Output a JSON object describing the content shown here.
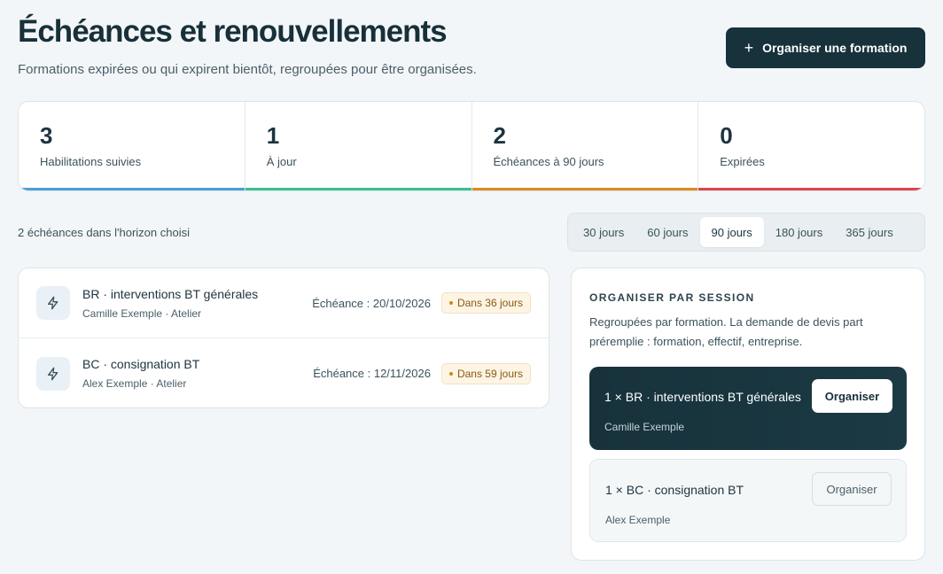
{
  "header": {
    "title": "Échéances et renouvellements",
    "subtitle": "Formations expirées ou qui expirent bientôt, regroupées pour être organisées.",
    "primary_button": "Organiser une formation"
  },
  "stats": [
    {
      "value": "3",
      "label": "Habilitations suivies",
      "color": "#4a9fd4"
    },
    {
      "value": "1",
      "label": "À jour",
      "color": "#3bbf93"
    },
    {
      "value": "2",
      "label": "Échéances à 90 jours",
      "color": "#d98a24"
    },
    {
      "value": "0",
      "label": "Expirées",
      "color": "#d9474a"
    }
  ],
  "filter": {
    "count_text": "2 échéances dans l'horizon choisi",
    "options": [
      "30 jours",
      "60 jours",
      "90 jours",
      "180 jours",
      "365 jours"
    ],
    "selected": "90 jours"
  },
  "items": [
    {
      "title": "BR · interventions BT générales",
      "subtitle": "Camille Exemple · Atelier",
      "date": "Échéance : 20/10/2026",
      "badge": "Dans 36 jours",
      "icon": "bolt-icon"
    },
    {
      "title": "BC · consignation BT",
      "subtitle": "Alex Exemple · Atelier",
      "date": "Échéance : 12/11/2026",
      "badge": "Dans 59 jours",
      "icon": "bolt-icon"
    }
  ],
  "panel": {
    "heading": "ORGANISER PAR SESSION",
    "description": "Regroupées par formation. La demande de devis part préremplie : formation, effectif, entreprise.",
    "sessions": [
      {
        "title": "1 × BR · interventions BT générales",
        "subtitle": "Camille Exemple",
        "button": "Organiser"
      },
      {
        "title": "1 × BC · consignation BT",
        "subtitle": "Alex Exemple",
        "button": "Organiser"
      }
    ]
  }
}
